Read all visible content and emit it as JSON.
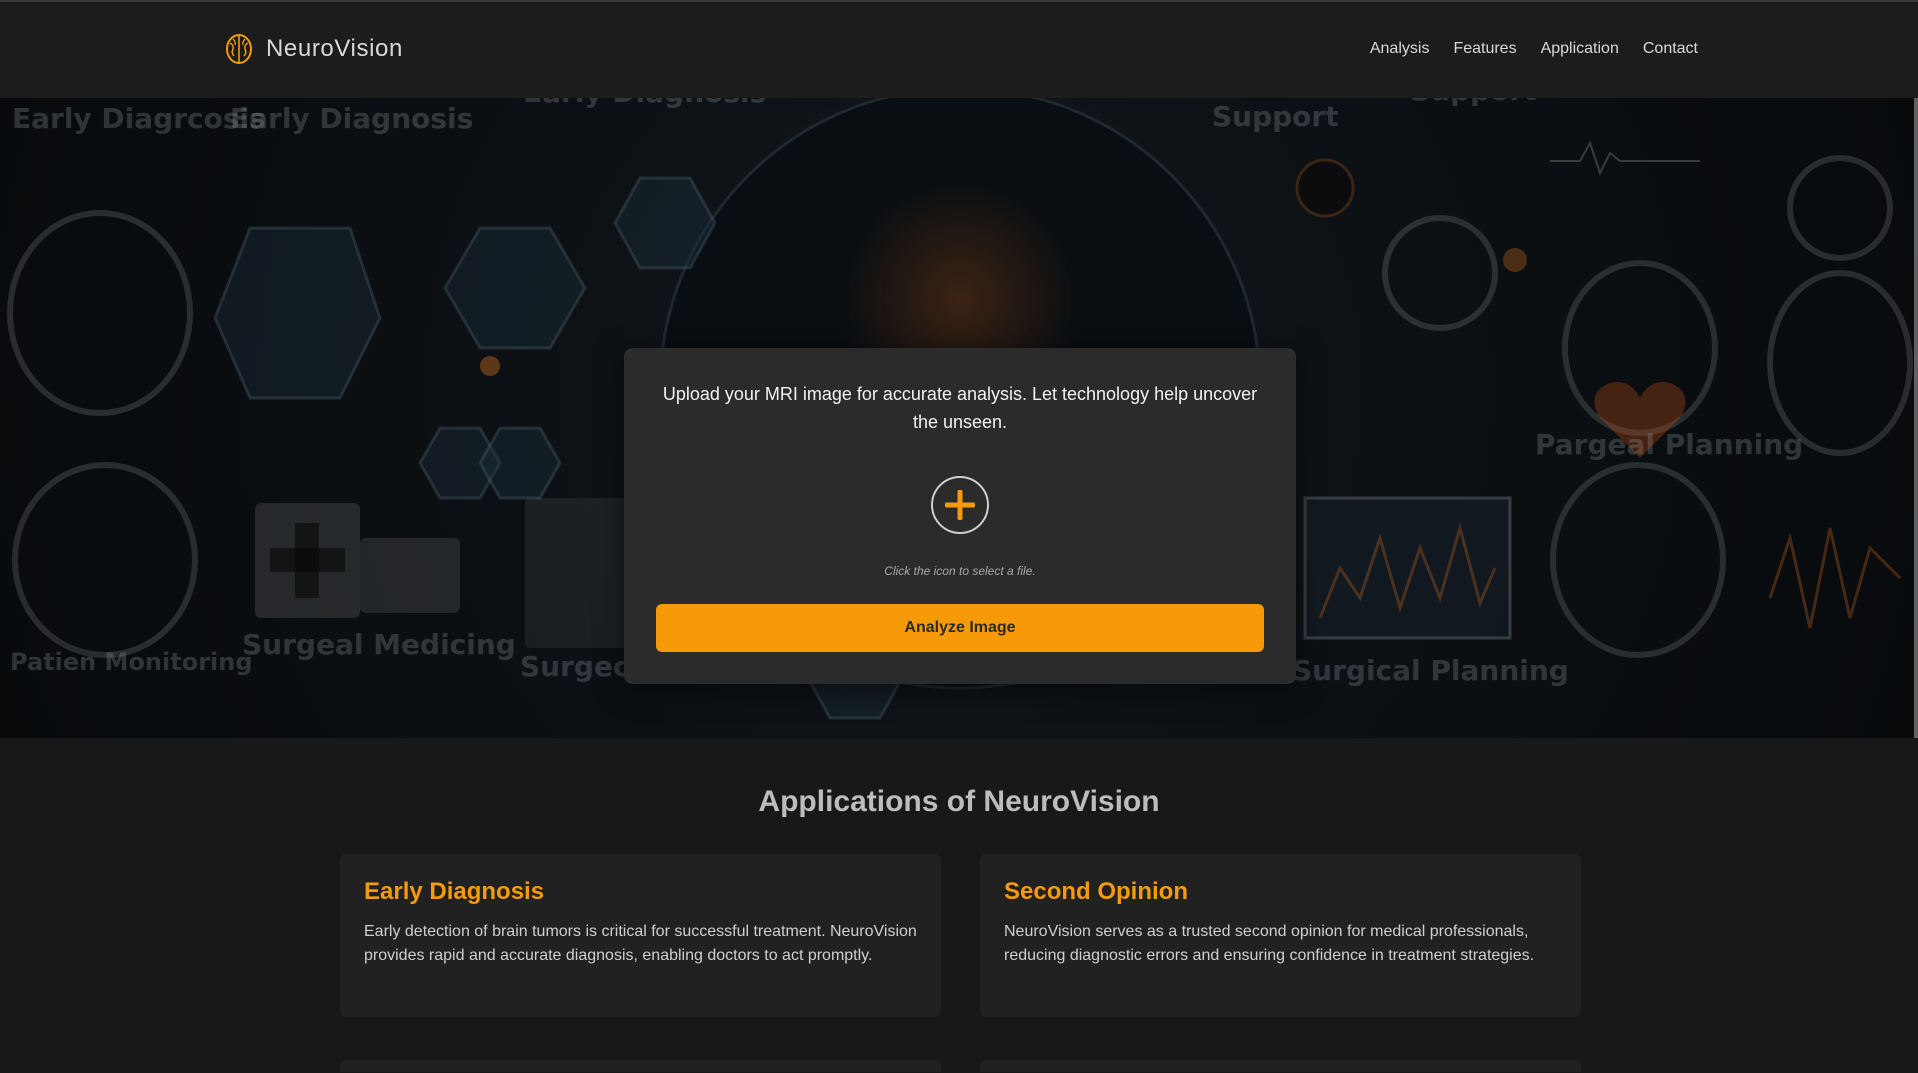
{
  "header": {
    "brand": "NeuroVision",
    "nav": [
      "Analysis",
      "Features",
      "Application",
      "Contact"
    ]
  },
  "hero": {
    "background_labels": [
      "Early Diagrcosis",
      "Early Diagnosis",
      "Early Diagnosis",
      "Support",
      "Support",
      "Pargeal Planning",
      "Surgeal Medicing",
      "Surgecal Planning",
      "Surgical Planning",
      "Patien Monitoring"
    ]
  },
  "upload": {
    "text": "Upload your MRI image for accurate analysis. Let technology help uncover the unseen.",
    "hint": "Click the icon to select a file.",
    "analyze_label": "Analyze Image"
  },
  "applications": {
    "title": "Applications of NeuroVision",
    "cards": [
      {
        "title": "Early Diagnosis",
        "text": "Early detection of brain tumors is critical for successful treatment. NeuroVision provides rapid and accurate diagnosis, enabling doctors to act promptly."
      },
      {
        "title": "Second Opinion",
        "text": "NeuroVision serves as a trusted second opinion for medical professionals, reducing diagnostic errors and ensuring confidence in treatment strategies."
      }
    ]
  },
  "colors": {
    "accent": "#f79a0a",
    "background": "#181818",
    "card": "#212121",
    "upload_card": "#2b2b2b"
  }
}
